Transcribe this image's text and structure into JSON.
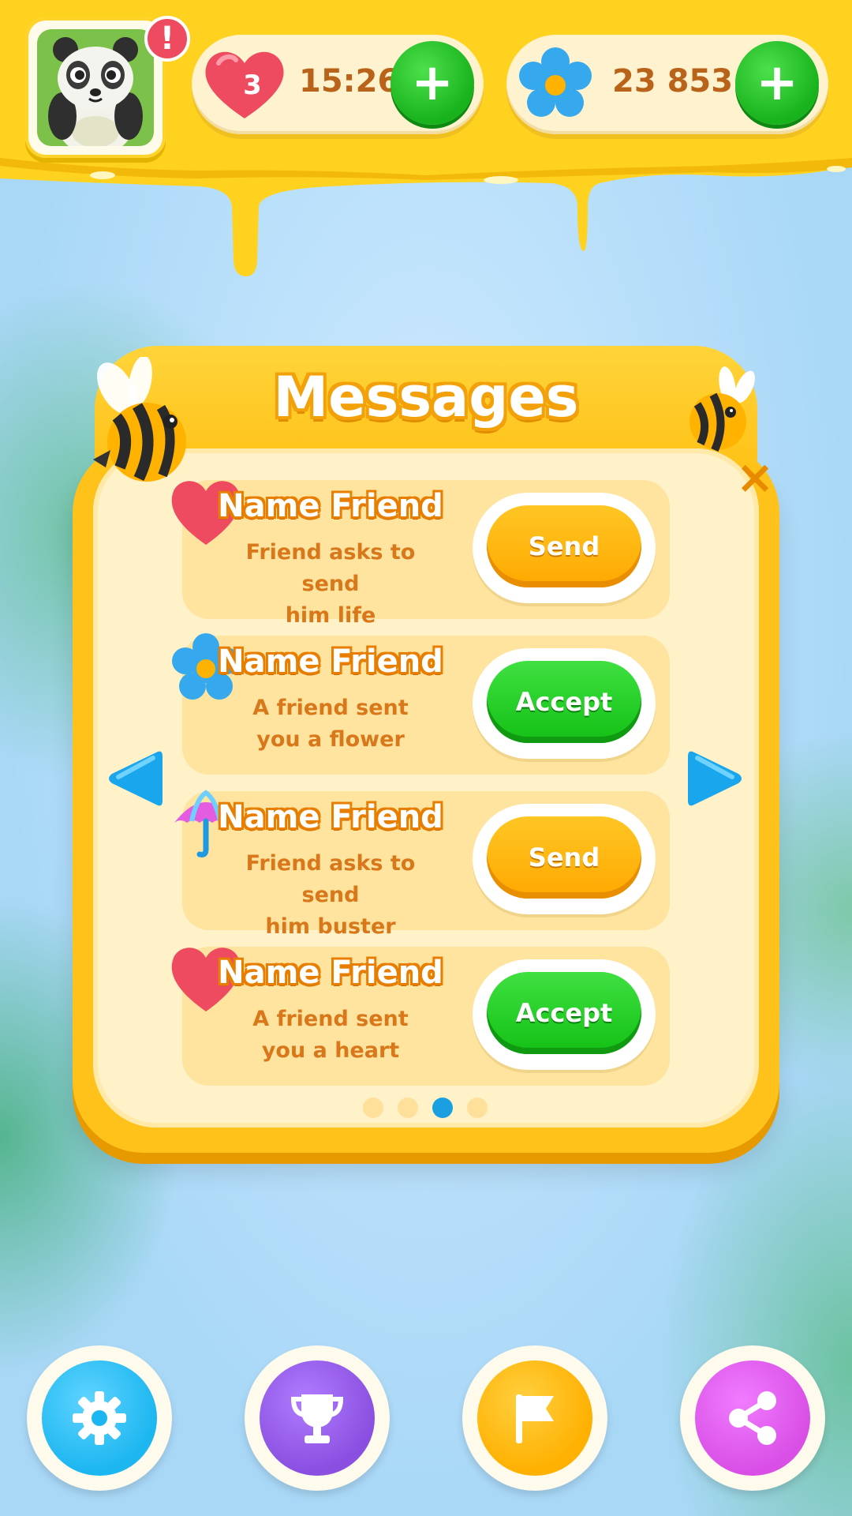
{
  "colors": {
    "honey": "#ffd21f",
    "accent_orange": "#ffb300",
    "green": "#18b21c",
    "heart": "#ef4b60",
    "active_dot": "#1aa0e0"
  },
  "header": {
    "avatar_icon": "panda-avatar",
    "alert_badge": "!",
    "lives": {
      "count": "3",
      "timer": "15:26",
      "plus_label": "+"
    },
    "flowers": {
      "amount": "23 853",
      "plus_label": "+"
    }
  },
  "dialog": {
    "title": "Messages",
    "close_label": "×",
    "messages": [
      {
        "icon": "heart-icon",
        "name": "Name Friend",
        "text_line1": "Friend asks to send",
        "text_line2": "him life",
        "action": "Send",
        "action_type": "send"
      },
      {
        "icon": "flower-icon",
        "name": "Name Friend",
        "text_line1": "A friend sent",
        "text_line2": "you a flower",
        "action": "Accept",
        "action_type": "accept"
      },
      {
        "icon": "umbrella-icon",
        "name": "Name Friend",
        "text_line1": "Friend asks to send",
        "text_line2": "him buster",
        "action": "Send",
        "action_type": "send"
      },
      {
        "icon": "heart-icon",
        "name": "Name Friend",
        "text_line1": "A friend sent",
        "text_line2": "you a heart",
        "action": "Accept",
        "action_type": "accept"
      }
    ],
    "pagination": {
      "pages": 4,
      "current": 3
    }
  },
  "bottom_nav": [
    {
      "icon": "gear-icon",
      "color": "#1cb6f0"
    },
    {
      "icon": "trophy-icon",
      "color": "#8a4fe0"
    },
    {
      "icon": "flag-icon",
      "color": "#ffb000"
    },
    {
      "icon": "share-icon",
      "color": "#d94fe6"
    }
  ]
}
